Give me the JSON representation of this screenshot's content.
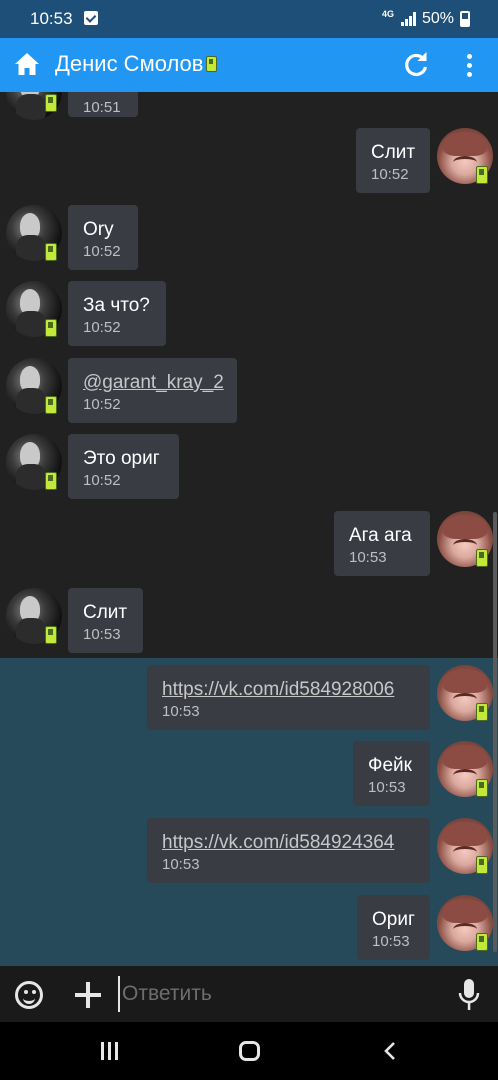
{
  "status_bar": {
    "time": "10:53",
    "network": "4G",
    "battery": "50%"
  },
  "toolbar": {
    "title": "Денис Смолов"
  },
  "messages": [
    {
      "side": "them",
      "text": "",
      "time": "10:51"
    },
    {
      "side": "me",
      "text": "Слит",
      "time": "10:52"
    },
    {
      "side": "them",
      "text": "Ory",
      "time": "10:52"
    },
    {
      "side": "them",
      "text": "За что?",
      "time": "10:52"
    },
    {
      "side": "them",
      "text": "@garant_kray_2",
      "time": "10:52",
      "link": true
    },
    {
      "side": "them",
      "text": "Это ориг",
      "time": "10:52"
    },
    {
      "side": "me",
      "text": "Ага ага",
      "time": "10:53"
    },
    {
      "side": "them",
      "text": "Слит",
      "time": "10:53"
    },
    {
      "side": "me",
      "text": "https://vk.com/id584928006",
      "time": "10:53",
      "link": true,
      "unread": true
    },
    {
      "side": "me",
      "text": "Фейк",
      "time": "10:53",
      "unread": true
    },
    {
      "side": "me",
      "text": "https://vk.com/id584924364",
      "time": "10:53",
      "link": true,
      "unread": true
    },
    {
      "side": "me",
      "text": "Ориг",
      "time": "10:53",
      "unread": true
    }
  ],
  "composer": {
    "placeholder": "Ответить"
  },
  "icons": {
    "toolbar": [
      "home-icon",
      "refresh-icon",
      "more-vert-icon"
    ],
    "composer": [
      "emoji-icon",
      "plus-icon",
      "mic-icon"
    ],
    "navbar": [
      "recents-icon",
      "home-nav-icon",
      "back-icon"
    ]
  },
  "colors": {
    "toolbar": "#2196f3",
    "status_bar": "#1d4f78",
    "chat_bg": "#212121",
    "unread_bg": "#264a5a",
    "bubble": "#3a3c44"
  }
}
